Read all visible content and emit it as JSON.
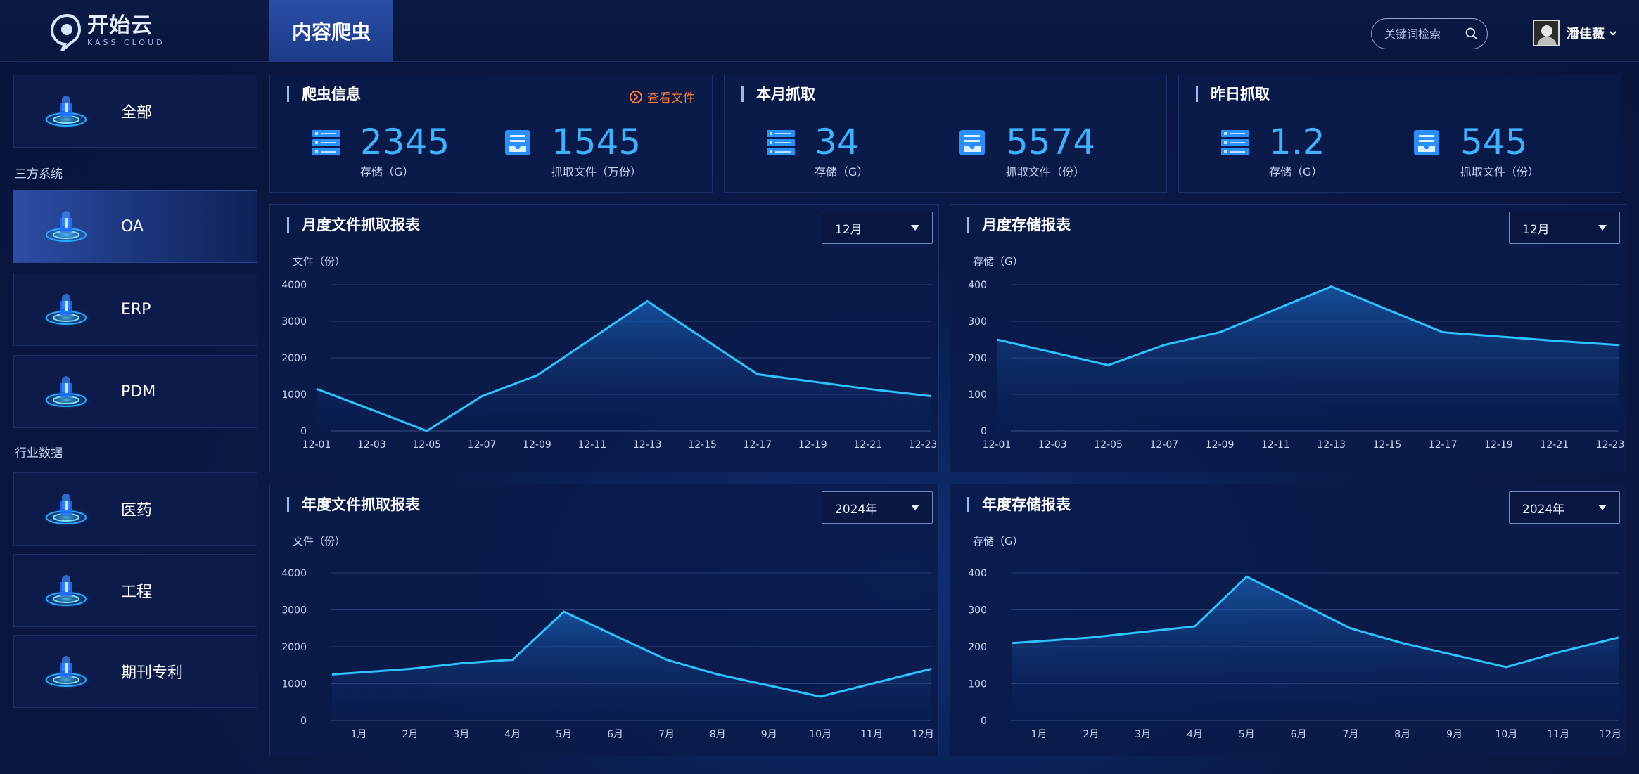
{
  "header": {
    "logo_cn": "开始云",
    "logo_en": "KASS CLOUD",
    "page_title": "内容爬虫",
    "search_placeholder": "关键词检索",
    "user_name": "潘佳薇"
  },
  "sidebar": {
    "items_top": [
      {
        "label": "全部"
      }
    ],
    "section1": "三方系统",
    "items_sys": [
      {
        "label": "OA",
        "active": true
      },
      {
        "label": "ERP"
      },
      {
        "label": "PDM"
      }
    ],
    "section2": "行业数据",
    "items_ind": [
      {
        "label": "医药"
      },
      {
        "label": "工程"
      },
      {
        "label": "期刊专利"
      }
    ]
  },
  "stats": [
    {
      "title": "爬虫信息",
      "link": "查看文件",
      "a_value": "2345",
      "a_label": "存储（G）",
      "b_value": "1545",
      "b_label": "抓取文件（万份）"
    },
    {
      "title": "本月抓取",
      "a_value": "34",
      "a_label": "存储（G）",
      "b_value": "5574",
      "b_label": "抓取文件（份）"
    },
    {
      "title": "昨日抓取",
      "a_value": "1.2",
      "a_label": "存储（G）",
      "b_value": "545",
      "b_label": "抓取文件（份）"
    }
  ],
  "colors": {
    "accent": "#3fb1ff",
    "link": "#ff7a3a",
    "line": "#2ec2ff"
  },
  "chart_data": [
    {
      "type": "area",
      "title": "月度文件抓取报表",
      "select": "12月",
      "ylabel": "文件（份）",
      "ylim": [
        0,
        4000
      ],
      "yticks": [
        0,
        1000,
        2000,
        3000,
        4000
      ],
      "categories": [
        "12-01",
        "12-03",
        "12-05",
        "12-07",
        "12-09",
        "12-11",
        "12-13",
        "12-15",
        "12-17",
        "12-19",
        "12-21",
        "12-23"
      ],
      "values": [
        1150,
        580,
        0,
        950,
        1520,
        null,
        3550,
        null,
        1550,
        null,
        null,
        950
      ]
    },
    {
      "type": "area",
      "title": "月度存储报表",
      "select": "12月",
      "ylabel": "存储（G）",
      "ylim": [
        0,
        400
      ],
      "yticks": [
        0,
        100,
        200,
        300,
        400
      ],
      "categories": [
        "12-01",
        "12-03",
        "12-05",
        "12-07",
        "12-09",
        "12-11",
        "12-13",
        "12-15",
        "12-17",
        "12-19",
        "12-21",
        "12-23"
      ],
      "values": [
        250,
        null,
        180,
        235,
        270,
        null,
        395,
        null,
        270,
        null,
        null,
        235
      ]
    },
    {
      "type": "area",
      "title": "年度文件抓取报表",
      "select": "2024年",
      "ylabel": "文件（份）",
      "ylim": [
        0,
        4000
      ],
      "yticks": [
        0,
        1000,
        2000,
        3000,
        4000
      ],
      "categories": [
        "1月",
        "2月",
        "3月",
        "4月",
        "5月",
        "6月",
        "7月",
        "8月",
        "9月",
        "10月",
        "11月",
        "12月"
      ],
      "values": [
        1250,
        1400,
        1550,
        1650,
        2950,
        null,
        1650,
        1250,
        null,
        650,
        1000,
        1400
      ]
    },
    {
      "type": "area",
      "title": "年度存储报表",
      "select": "2024年",
      "ylabel": "存储（G）",
      "ylim": [
        0,
        400
      ],
      "yticks": [
        0,
        100,
        200,
        300,
        400
      ],
      "categories": [
        "1月",
        "2月",
        "3月",
        "4月",
        "5月",
        "6月",
        "7月",
        "8月",
        "9月",
        "10月",
        "11月",
        "12月"
      ],
      "values": [
        210,
        null,
        240,
        255,
        390,
        null,
        250,
        210,
        null,
        145,
        null,
        225
      ]
    }
  ]
}
